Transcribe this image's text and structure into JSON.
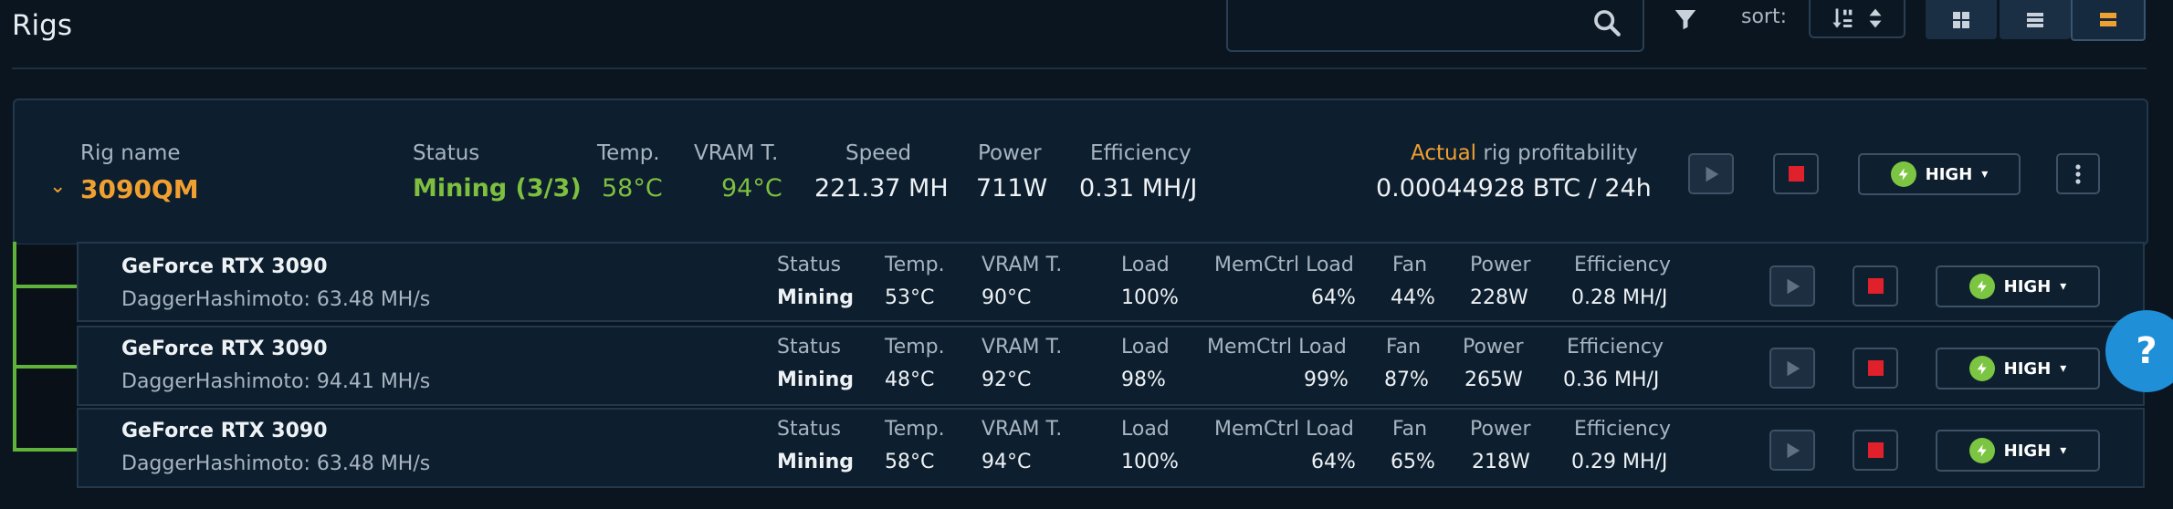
{
  "page": {
    "title": "Rigs"
  },
  "toolbar": {
    "search_placeholder": "",
    "sort_label": "sort:",
    "views": [
      "grid-view",
      "list-view",
      "detailed-view"
    ]
  },
  "rig": {
    "name_label": "Rig name",
    "name": "3090QM",
    "status_label": "Status",
    "status": "Mining (3/3)",
    "temp_label": "Temp.",
    "temp": "58°C",
    "vram_label": "VRAM T.",
    "vram": "94°C",
    "speed_label": "Speed",
    "speed": "221.37 MH",
    "power_label": "Power",
    "power": "711W",
    "eff_label": "Efficiency",
    "eff": "0.31 MH/J",
    "profit_label_highlight": "Actual",
    "profit_label_rest": " rig profitability",
    "profit": "0.00044928 BTC / 24h",
    "mode": "HIGH"
  },
  "devices": [
    {
      "name": "GeForce RTX 3090",
      "algo": "DaggerHashimoto: 63.48 MH/s",
      "status": "Mining",
      "temp": "53°C",
      "vram": "90°C",
      "load": "100%",
      "memctrl": "64%",
      "fan": "44%",
      "power": "228W",
      "eff": "0.28 MH/J",
      "mode": "HIGH"
    },
    {
      "name": "GeForce RTX 3090",
      "algo": "DaggerHashimoto: 94.41 MH/s",
      "status": "Mining",
      "temp": "48°C",
      "vram": "92°C",
      "load": "98%",
      "memctrl": "99%",
      "fan": "87%",
      "power": "265W",
      "eff": "0.36 MH/J",
      "mode": "HIGH"
    },
    {
      "name": "GeForce RTX 3090",
      "algo": "DaggerHashimoto: 63.48 MH/s",
      "status": "Mining",
      "temp": "58°C",
      "vram": "94°C",
      "load": "100%",
      "memctrl": "64%",
      "fan": "65%",
      "power": "218W",
      "eff": "0.29 MH/J",
      "mode": "HIGH"
    }
  ],
  "device_labels": {
    "status": "Status",
    "temp": "Temp.",
    "vram": "VRAM T.",
    "load": "Load",
    "memctrl": "MemCtrl Load",
    "fan": "Fan",
    "power": "Power",
    "eff": "Efficiency"
  },
  "help": {
    "label": "?"
  },
  "colors": {
    "accent": "#f0a030",
    "ok": "#7dbf3f",
    "stop": "#e0202a",
    "help": "#1f8fd8"
  }
}
